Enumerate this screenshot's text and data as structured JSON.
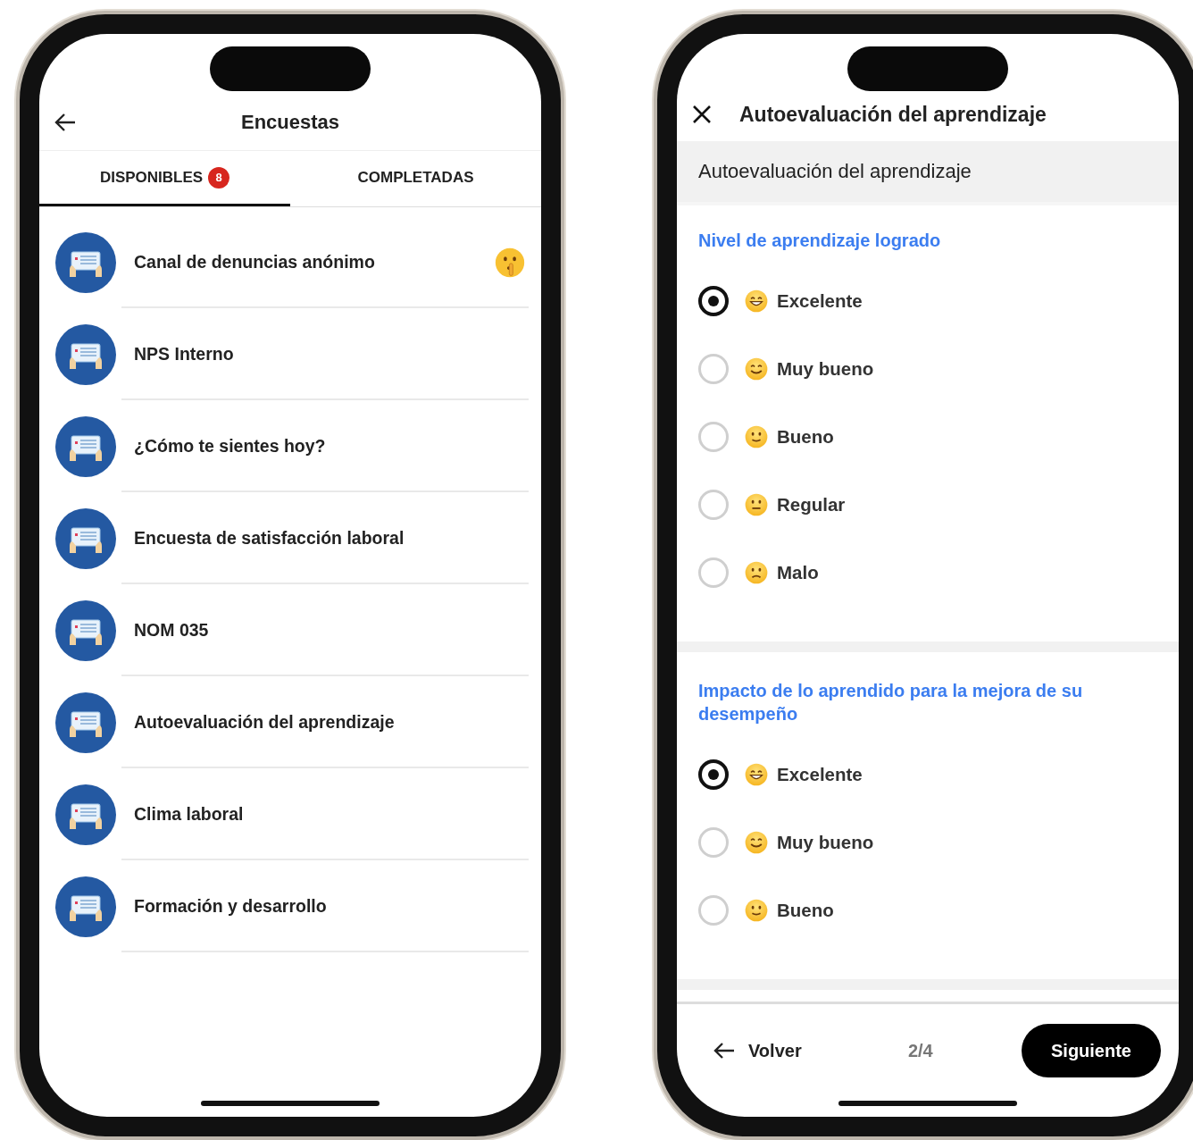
{
  "left_phone": {
    "header": {
      "title": "Encuestas"
    },
    "tabs": [
      {
        "label": "DISPONIBLES",
        "badge": "8",
        "selected": true
      },
      {
        "label": "COMPLETADAS",
        "selected": false
      }
    ],
    "surveys": [
      {
        "title": "Canal de denuncias anónimo",
        "anonymous": true
      },
      {
        "title": "NPS Interno",
        "anonymous": false
      },
      {
        "title": "¿Cómo te sientes hoy?",
        "anonymous": false
      },
      {
        "title": "Encuesta de satisfacción laboral",
        "anonymous": false
      },
      {
        "title": "NOM 035",
        "anonymous": false
      },
      {
        "title": "Autoevaluación del aprendizaje",
        "anonymous": false
      },
      {
        "title": "Clima laboral",
        "anonymous": false
      },
      {
        "title": "Formación y desarrollo",
        "anonymous": false
      }
    ]
  },
  "right_phone": {
    "header": {
      "title": "Autoevaluación del aprendizaje"
    },
    "section_title": "Autoevaluación del aprendizaje",
    "questions": [
      {
        "title": "Nivel de aprendizaje logrado",
        "options": [
          {
            "label": "Excelente",
            "kind": "grin",
            "selected": true
          },
          {
            "label": "Muy bueno",
            "kind": "smile",
            "selected": false
          },
          {
            "label": "Bueno",
            "kind": "slight",
            "selected": false
          },
          {
            "label": "Regular",
            "kind": "neutral",
            "selected": false
          },
          {
            "label": "Malo",
            "kind": "frown",
            "selected": false
          }
        ]
      },
      {
        "title": "Impacto de lo aprendido para la mejora de su desempeño",
        "options": [
          {
            "label": "Excelente",
            "kind": "grin",
            "selected": true
          },
          {
            "label": "Muy bueno",
            "kind": "smile",
            "selected": false
          },
          {
            "label": "Bueno",
            "kind": "slight",
            "selected": false
          }
        ]
      }
    ],
    "footer": {
      "back": "Volver",
      "progress": "2/4",
      "next": "Siguiente"
    }
  }
}
